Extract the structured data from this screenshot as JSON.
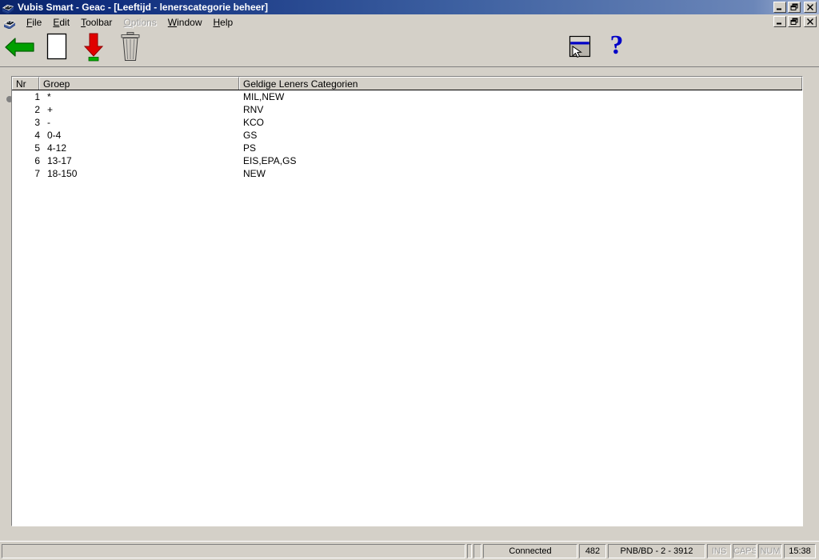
{
  "window": {
    "title": "Vubis Smart - Geac - [Leeftijd - lenerscategorie beheer]",
    "title_icon": "books-stack-icon",
    "buttons": {
      "minimize": "_",
      "restore": "❐",
      "close": "✕"
    }
  },
  "menubar": {
    "icon": "books-stack-icon",
    "items": [
      {
        "label": "File",
        "accel": "F",
        "disabled": false
      },
      {
        "label": "Edit",
        "accel": "E",
        "disabled": false
      },
      {
        "label": "Toolbar",
        "accel": "T",
        "disabled": false
      },
      {
        "label": "Options",
        "accel": "O",
        "disabled": true
      },
      {
        "label": "Window",
        "accel": "W",
        "disabled": false
      },
      {
        "label": "Help",
        "accel": "H",
        "disabled": false
      }
    ],
    "mdi_buttons": {
      "minimize": "_",
      "restore": "❐",
      "close": "✕"
    }
  },
  "toolbar": {
    "left_buttons": [
      {
        "name": "back-arrow-icon",
        "tooltip": "Back",
        "color": "#00a000"
      },
      {
        "name": "new-page-icon",
        "tooltip": "New",
        "color": "#ffffff"
      },
      {
        "name": "red-down-arrow-icon",
        "tooltip": "Insert / Down",
        "color": "#e00000"
      },
      {
        "name": "trash-can-icon",
        "tooltip": "Delete",
        "color": "#808080"
      }
    ],
    "right_buttons": [
      {
        "name": "select-window-icon",
        "tooltip": "Select",
        "color": "#0000c0"
      },
      {
        "name": "help-question-icon",
        "tooltip": "Help",
        "color": "#0000c0"
      }
    ]
  },
  "grid": {
    "columns": [
      "Nr",
      "Groep",
      "Geldige Leners Categorien"
    ],
    "row_marker_row": 1,
    "rows": [
      {
        "nr": "1",
        "groep": "*",
        "categorien": "MIL,NEW"
      },
      {
        "nr": "2",
        "groep": "+",
        "categorien": "RNV"
      },
      {
        "nr": "3",
        "groep": "-",
        "categorien": "KCO"
      },
      {
        "nr": "4",
        "groep": "0-4",
        "categorien": "GS"
      },
      {
        "nr": "5",
        "groep": "4-12",
        "categorien": "PS"
      },
      {
        "nr": "6",
        "groep": "13-17",
        "categorien": "EIS,EPA,GS"
      },
      {
        "nr": "7",
        "groep": "18-150",
        "categorien": "NEW"
      }
    ]
  },
  "statusbar": {
    "message": "",
    "spacer1": "",
    "spacer2": "",
    "connection": "Connected",
    "count": "482",
    "identifier": "PNB/BD - 2 - 3912",
    "ins": "INS",
    "caps": "CAPS",
    "num": "NUM",
    "time": "15:38"
  },
  "colors": {
    "face": "#d4d0c8",
    "title_start": "#0a246a",
    "title_end": "#a6b5d4",
    "accent_green": "#00a000",
    "accent_red": "#e00000",
    "accent_blue": "#0000c0",
    "grid_bg": "#ffffff"
  }
}
